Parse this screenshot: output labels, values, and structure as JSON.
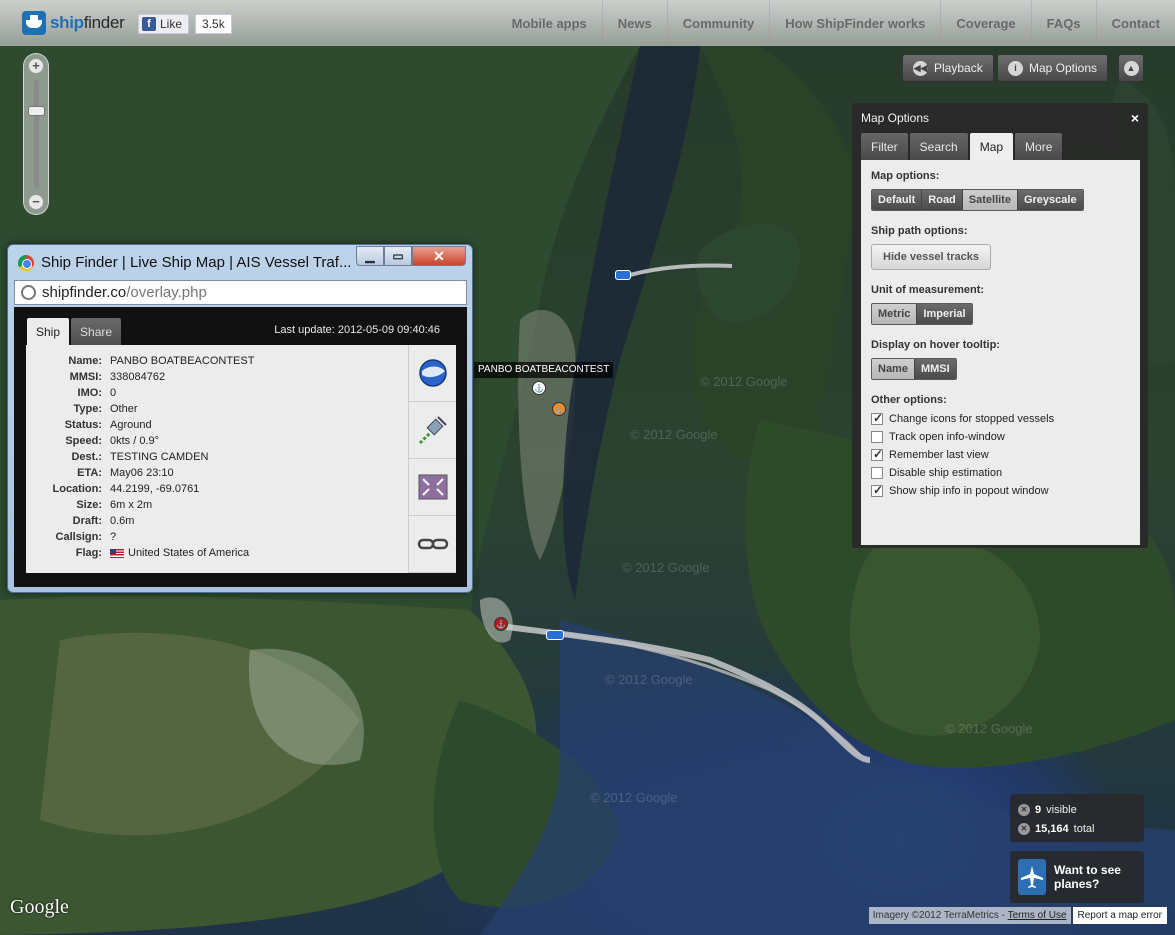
{
  "brand": {
    "name_part1": "ship",
    "name_part2": "finder"
  },
  "facebook": {
    "like_label": "Like",
    "count": "3.5k"
  },
  "nav": [
    {
      "label": "Mobile apps"
    },
    {
      "label": "News"
    },
    {
      "label": "Community"
    },
    {
      "label": "How ShipFinder works"
    },
    {
      "label": "Coverage"
    },
    {
      "label": "FAQs"
    },
    {
      "label": "Contact"
    }
  ],
  "toolbar": {
    "playback_label": "Playback",
    "map_options_label": "Map Options"
  },
  "map_options": {
    "title": "Map Options",
    "close": "×",
    "tabs": [
      "Filter",
      "Search",
      "Map",
      "More"
    ],
    "active_tab": "Map",
    "map_options_label": "Map options:",
    "map_types": [
      "Default",
      "Road",
      "Satellite",
      "Greyscale"
    ],
    "map_type_selected": "Satellite",
    "ship_path_label": "Ship path options:",
    "hide_tracks_label": "Hide vessel tracks",
    "units_label": "Unit of measurement:",
    "units": [
      "Metric",
      "Imperial"
    ],
    "unit_selected": "Metric",
    "hover_label": "Display on hover tooltip:",
    "hover": [
      "Name",
      "MMSI"
    ],
    "hover_selected": "Name",
    "other_label": "Other options:",
    "other": [
      {
        "label": "Change icons for stopped vessels",
        "checked": true
      },
      {
        "label": "Track open info-window",
        "checked": false
      },
      {
        "label": "Remember last view",
        "checked": true
      },
      {
        "label": "Disable ship estimation",
        "checked": false
      },
      {
        "label": "Show ship info in popout window",
        "checked": true
      }
    ]
  },
  "popup": {
    "window_title": "Ship Finder | Live Ship Map | AIS Vessel Traf...",
    "url_host": "shipfinder.co",
    "url_path": "/overlay.php",
    "tabs": [
      "Ship",
      "Share"
    ],
    "last_update": "Last update: 2012-05-09 09:40:46",
    "fields": [
      {
        "k": "Name:",
        "v": "PANBO BOATBEACONTEST"
      },
      {
        "k": "MMSI:",
        "v": "338084762"
      },
      {
        "k": "IMO:",
        "v": "0"
      },
      {
        "k": "Type:",
        "v": "Other"
      },
      {
        "k": "Status:",
        "v": "Aground"
      },
      {
        "k": "Speed:",
        "v": "0kts / 0.9°"
      },
      {
        "k": "Dest.:",
        "v": "TESTING CAMDEN"
      },
      {
        "k": "ETA:",
        "v": "May06 23:10"
      },
      {
        "k": "Location:",
        "v": "44.2199, -69.0761"
      },
      {
        "k": "Size:",
        "v": "6m x 2m"
      },
      {
        "k": "Draft:",
        "v": "0.6m"
      },
      {
        "k": "Callsign:",
        "v": "?"
      },
      {
        "k": "Flag:",
        "v": "United States of America"
      }
    ]
  },
  "map": {
    "ship_label": "PANBO BOATBEACONTEST",
    "watermark": "© 2012 Google",
    "google_logo": "Google"
  },
  "counts": {
    "visible": "9",
    "visible_label": "visible",
    "total": "15,164",
    "total_label": "total"
  },
  "planes": {
    "text": "Want to see planes?"
  },
  "footer": {
    "imagery": "Imagery ©2012 TerraMetrics - ",
    "terms": "Terms of Use",
    "report": "Report a map error"
  }
}
